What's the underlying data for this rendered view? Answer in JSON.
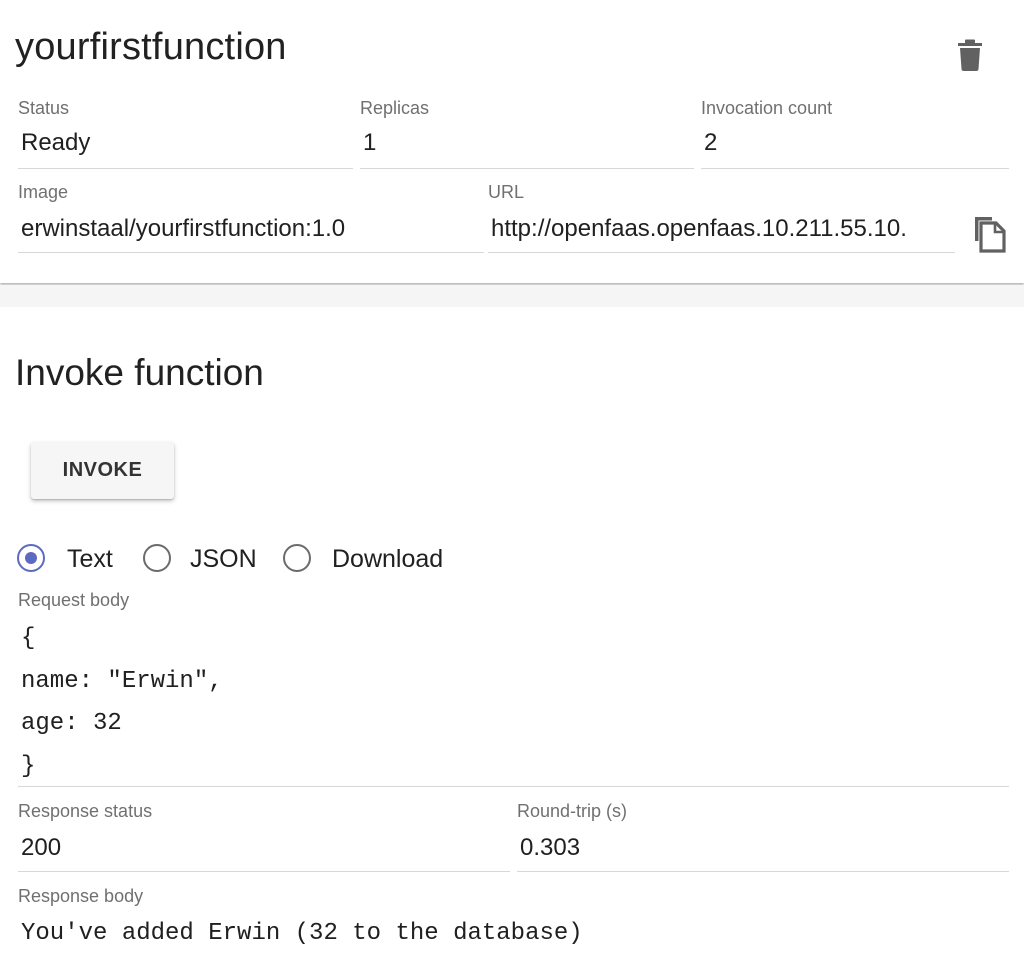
{
  "function": {
    "name": "yourfirstfunction",
    "status_label": "Status",
    "status_value": "Ready",
    "replicas_label": "Replicas",
    "replicas_value": "1",
    "invocation_label": "Invocation count",
    "invocation_value": "2",
    "image_label": "Image",
    "image_value": "erwinstaal/yourfirstfunction:1.0",
    "url_label": "URL",
    "url_value": "http://openfaas.openfaas.10.211.55.10.",
    "delete_icon": "trash-icon",
    "copy_icon": "copy-icon"
  },
  "invoke": {
    "title": "Invoke function",
    "button_label": "INVOKE",
    "content_types": [
      "Text",
      "JSON",
      "Download"
    ],
    "selected_type": "Text",
    "request_body_label": "Request body",
    "request_body_lines": [
      "{",
      "name: \"Erwin\",",
      "age: 32",
      "}"
    ],
    "response_status_label": "Response status",
    "response_status_value": "200",
    "roundtrip_label": "Round-trip (s)",
    "roundtrip_value": "0.303",
    "response_body_label": "Response body",
    "response_body_value": "You've added Erwin (32 to the database)"
  },
  "colors": {
    "accent": "#5c6bc0",
    "icon": "#616161",
    "label": "#707070"
  }
}
